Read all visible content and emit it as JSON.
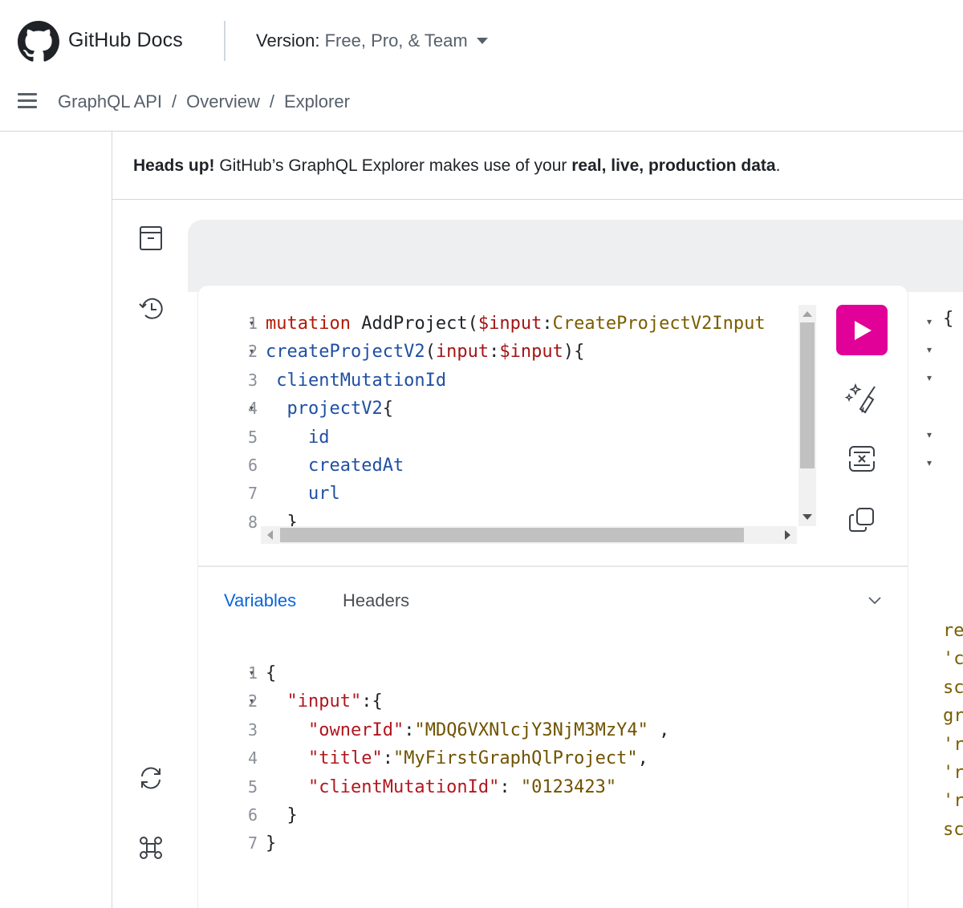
{
  "header": {
    "brand": "GitHub Docs",
    "version_label": "Version:",
    "version_value": " Free, Pro, & Team"
  },
  "breadcrumb": [
    "GraphQL API",
    "Overview",
    "Explorer"
  ],
  "banner": {
    "prefix_bold": "Heads up!",
    "middle": " GitHub’s GraphQL Explorer makes use of your ",
    "emphasis_bold": "real, live, production data",
    "suffix": "."
  },
  "query_editor": {
    "line_numbers": [
      "1",
      "2",
      "3",
      "4",
      "5",
      "6",
      "7",
      "8"
    ],
    "lines": [
      {
        "tokens": [
          {
            "t": "mutation",
            "c": "kw"
          },
          {
            "t": " AddProject(",
            "c": "def"
          },
          {
            "t": "$input",
            "c": "var"
          },
          {
            "t": ":",
            "c": "pun"
          },
          {
            "t": "CreateProjectV2Input",
            "c": "typ"
          }
        ]
      },
      {
        "tokens": [
          {
            "t": "createProjectV2",
            "c": "fld"
          },
          {
            "t": "(",
            "c": "pun"
          },
          {
            "t": "input",
            "c": "var"
          },
          {
            "t": ":",
            "c": "pun"
          },
          {
            "t": "$input",
            "c": "var"
          },
          {
            "t": "){",
            "c": "pun"
          }
        ]
      },
      {
        "tokens": [
          {
            "t": " clientMutationId",
            "c": "fld"
          }
        ]
      },
      {
        "tokens": [
          {
            "t": "  projectV2",
            "c": "fld"
          },
          {
            "t": "{",
            "c": "pun"
          }
        ]
      },
      {
        "tokens": [
          {
            "t": "    id",
            "c": "fld"
          }
        ]
      },
      {
        "tokens": [
          {
            "t": "    createdAt",
            "c": "fld"
          }
        ]
      },
      {
        "tokens": [
          {
            "t": "    url",
            "c": "fld"
          }
        ]
      },
      {
        "tokens": [
          {
            "t": "  }",
            "c": "pun"
          }
        ]
      }
    ]
  },
  "tabs": {
    "variables": "Variables",
    "headers": "Headers"
  },
  "variables_editor": {
    "line_numbers": [
      "1",
      "2",
      "3",
      "4",
      "5",
      "6",
      "7"
    ],
    "lines": [
      {
        "tokens": [
          {
            "t": "{",
            "c": "pun"
          }
        ]
      },
      {
        "tokens": [
          {
            "t": "  ",
            "c": "pun"
          },
          {
            "t": "\"input\"",
            "c": "key"
          },
          {
            "t": ":{",
            "c": "pun"
          }
        ]
      },
      {
        "tokens": [
          {
            "t": "    ",
            "c": "pun"
          },
          {
            "t": "\"ownerId\"",
            "c": "key"
          },
          {
            "t": ":",
            "c": "pun"
          },
          {
            "t": "\"MDQ6VXNlcjY3NjM3MzY4\"",
            "c": "str"
          },
          {
            "t": " ,",
            "c": "pun"
          }
        ]
      },
      {
        "tokens": [
          {
            "t": "    ",
            "c": "pun"
          },
          {
            "t": "\"title\"",
            "c": "key"
          },
          {
            "t": ":",
            "c": "pun"
          },
          {
            "t": "\"MyFirstGraphQlProject\"",
            "c": "str"
          },
          {
            "t": ",",
            "c": "pun"
          }
        ]
      },
      {
        "tokens": [
          {
            "t": "    ",
            "c": "pun"
          },
          {
            "t": "\"clientMutationId\"",
            "c": "key"
          },
          {
            "t": ": ",
            "c": "pun"
          },
          {
            "t": "\"0123423\"",
            "c": "str"
          }
        ]
      },
      {
        "tokens": [
          {
            "t": "  }",
            "c": "pun"
          }
        ]
      },
      {
        "tokens": [
          {
            "t": "}",
            "c": "pun"
          }
        ]
      }
    ]
  },
  "result_pane": {
    "brace": "{",
    "fragments": [
      "re",
      "'c",
      "sc",
      "gr",
      "'r",
      "'r",
      "'r",
      "sc"
    ]
  },
  "icons": {
    "sidebar": [
      "docs-icon",
      "history-icon",
      "refetch-icon",
      "shortcuts-icon"
    ],
    "toolbar": [
      "execute-icon",
      "prettify-icon",
      "merge-icon",
      "copy-icon"
    ]
  },
  "colors": {
    "run_button": "#e10098",
    "active_tab": "#0a66d8"
  }
}
